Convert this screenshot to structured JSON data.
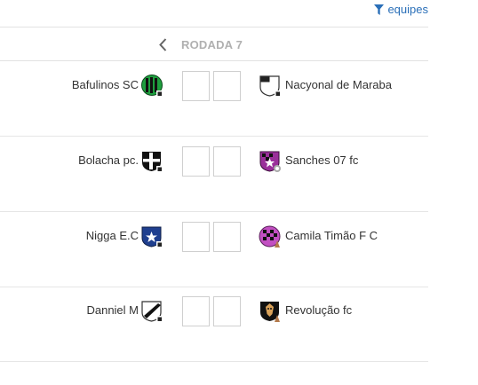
{
  "header": {
    "filter_label": "equipes",
    "filter_icon": "filter-icon"
  },
  "round": {
    "label": "RODADA 7",
    "prev_icon": "chevron-left-icon"
  },
  "matches": [
    {
      "home": "Bafulinos SC",
      "away": "Nacyonal de Maraba",
      "home_score": "",
      "away_score": ""
    },
    {
      "home": "Bolacha pc.",
      "away": "Sanches 07 fc",
      "home_score": "",
      "away_score": ""
    },
    {
      "home": "Nigga E.C",
      "away": "Camila Timão F C",
      "home_score": "",
      "away_score": ""
    },
    {
      "home": "Danniel M",
      "away": "Revolução fc",
      "home_score": "",
      "away_score": ""
    }
  ],
  "colors": {
    "link": "#2a6fb8",
    "round_label": "#b0b0b0",
    "divider": "#e2e2e2"
  }
}
